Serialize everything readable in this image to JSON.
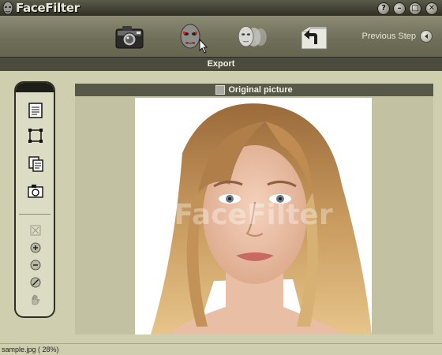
{
  "app": {
    "title": "FaceFilter"
  },
  "window_controls": {
    "help": "?",
    "minimize": "–",
    "maximize": "□",
    "close": "✕"
  },
  "toolbar": {
    "items": [
      {
        "icon": "camera-icon"
      },
      {
        "icon": "face-mask-pointer-icon"
      },
      {
        "icon": "faces-morph-icon"
      },
      {
        "icon": "export-folder-icon"
      }
    ],
    "previous_step": "Previous Step"
  },
  "step": {
    "title": "Export"
  },
  "left_tools": [
    {
      "icon": "document-icon"
    },
    {
      "icon": "selection-frame-icon"
    },
    {
      "icon": "copy-icon"
    },
    {
      "icon": "snapshot-icon"
    },
    {
      "icon": "fit-window-icon"
    },
    {
      "icon": "zoom-in-icon"
    },
    {
      "icon": "zoom-out-icon"
    },
    {
      "icon": "no-zoom-icon"
    },
    {
      "icon": "hand-pan-icon"
    }
  ],
  "content": {
    "header_label": "Original picture",
    "watermark": "FaceFilter"
  },
  "status": {
    "text": "sample.jpg ( 28%)"
  },
  "colors": {
    "accent": "#4c4c3e",
    "panel": "#c2c2a2",
    "background": "#cfcfb0"
  }
}
